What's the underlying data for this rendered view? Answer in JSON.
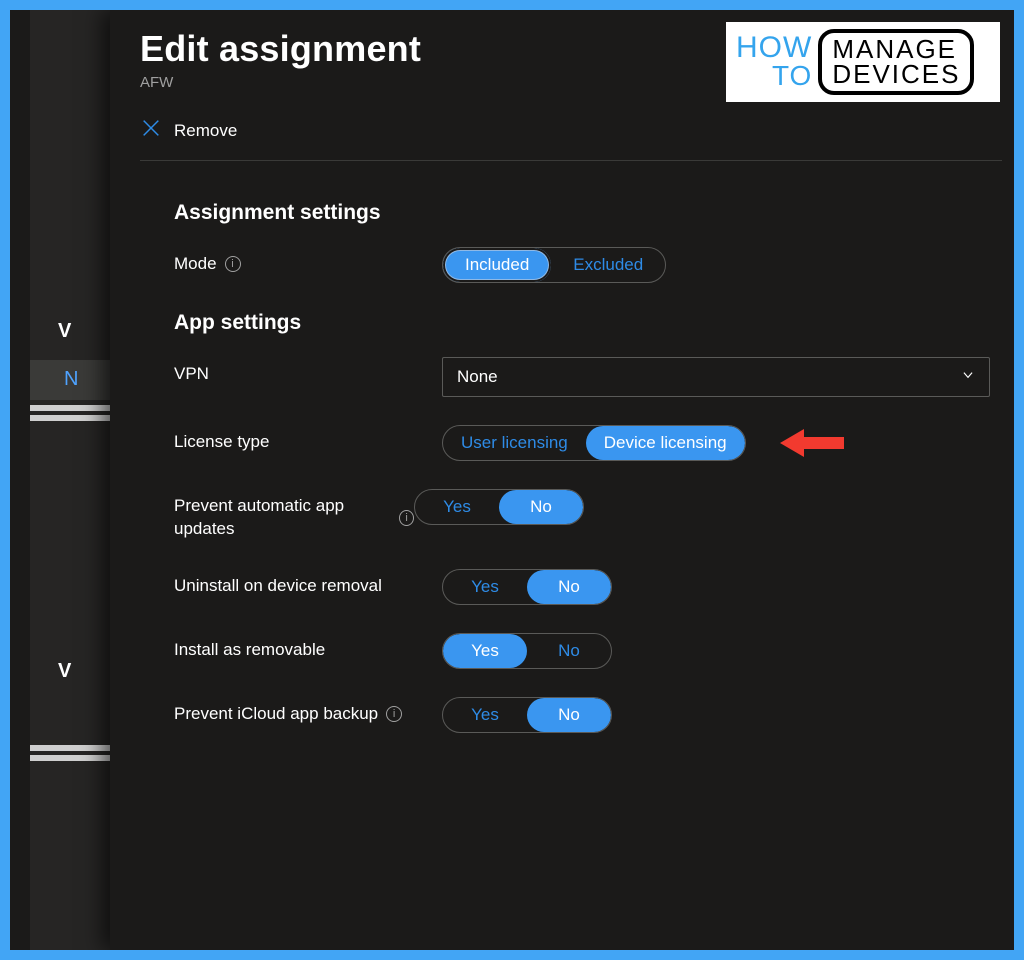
{
  "header": {
    "title": "Edit assignment",
    "subtitle": "AFW",
    "remove_label": "Remove"
  },
  "logo": {
    "how": "HOW",
    "to": "TO",
    "manage": "MANAGE",
    "devices": "DEVICES"
  },
  "section_assignment": "Assignment settings",
  "section_app": "App settings",
  "mode": {
    "label": "Mode",
    "options": {
      "included": "Included",
      "excluded": "Excluded"
    },
    "selected": "included"
  },
  "vpn": {
    "label": "VPN",
    "value": "None"
  },
  "license": {
    "label": "License type",
    "options": {
      "user": "User licensing",
      "device": "Device licensing"
    },
    "selected": "device"
  },
  "prevent_updates": {
    "label": "Prevent automatic app updates",
    "yes": "Yes",
    "no": "No",
    "selected": "no"
  },
  "uninstall_removal": {
    "label": "Uninstall on device removal",
    "yes": "Yes",
    "no": "No",
    "selected": "no"
  },
  "install_removable": {
    "label": "Install as removable",
    "yes": "Yes",
    "no": "No",
    "selected": "yes"
  },
  "prevent_icloud": {
    "label": "Prevent iCloud app backup",
    "yes": "Yes",
    "no": "No",
    "selected": "no"
  },
  "bg": {
    "v": "V",
    "n": "N"
  }
}
